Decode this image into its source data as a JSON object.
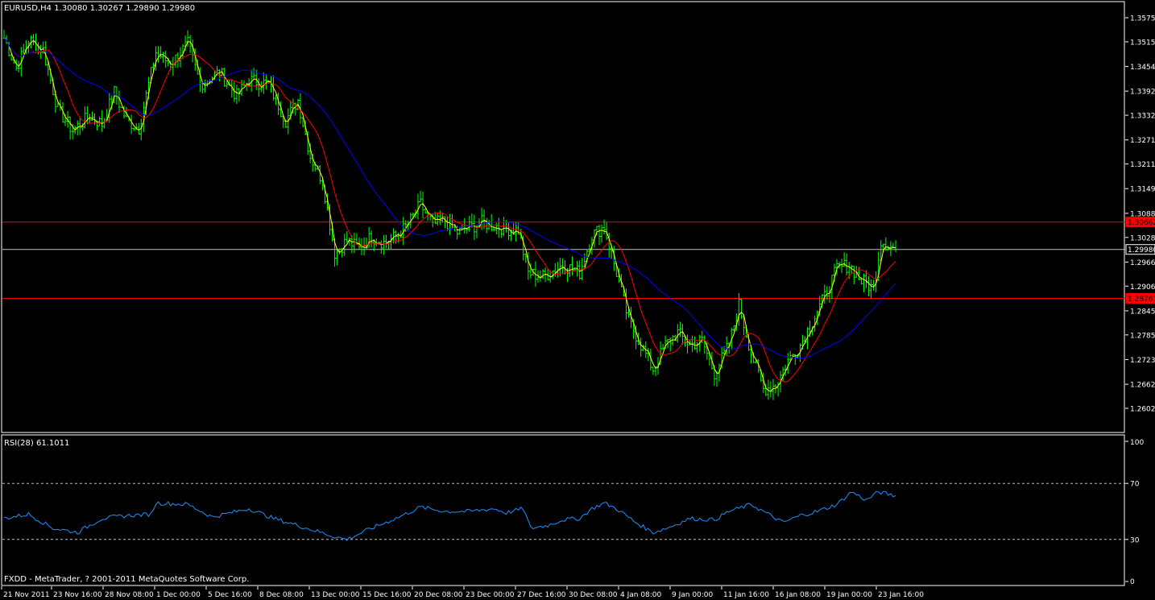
{
  "colors": {
    "background": "#000000",
    "frame": "#ffffff",
    "candle": "#00ff00",
    "ma_fast": "#ffff00",
    "ma_mid": "#ff0000",
    "ma_slow": "#0000ff",
    "resistance": "#ff0000",
    "current_price_line": "#c0c0c0",
    "rsi_line": "#1e90ff",
    "text": "#ffffff"
  },
  "chart_data": [
    {
      "type": "candlestick",
      "header": "EURUSD,H4  1.30080 1.30267 1.29890 1.29980",
      "ylim": [
        1.2602,
        1.3617
      ],
      "y_ticks": [
        "1.35755",
        "1.35155",
        "1.34540",
        "1.33925",
        "1.33325",
        "1.32710",
        "1.32110",
        "1.31495",
        "1.30880",
        "1.30280",
        "1.29665",
        "1.29065",
        "1.28450",
        "1.27850",
        "1.27235",
        "1.26620",
        "1.26020"
      ],
      "x_ticks": [
        "21 Nov 2011",
        "23 Nov 16:00",
        "28 Nov 08:00",
        "1 Dec 00:00",
        "5 Dec 16:00",
        "8 Dec 08:00",
        "13 Dec 00:00",
        "15 Dec 16:00",
        "20 Dec 08:00",
        "23 Dec 00:00",
        "27 Dec 16:00",
        "30 Dec 08:00",
        "4 Jan 08:00",
        "9 Jan 00:00",
        "11 Jan 16:00",
        "16 Jan 08:00",
        "19 Jan 00:00",
        "23 Jan 16:00"
      ],
      "close_waypoints": [
        [
          0,
          1.3525
        ],
        [
          5,
          1.345
        ],
        [
          10,
          1.352
        ],
        [
          16,
          1.3495
        ],
        [
          22,
          1.3345
        ],
        [
          28,
          1.3295
        ],
        [
          35,
          1.333
        ],
        [
          40,
          1.331
        ],
        [
          45,
          1.339
        ],
        [
          50,
          1.332
        ],
        [
          55,
          1.33
        ],
        [
          62,
          1.349
        ],
        [
          68,
          1.346
        ],
        [
          75,
          1.351
        ],
        [
          80,
          1.341
        ],
        [
          88,
          1.344
        ],
        [
          95,
          1.338
        ],
        [
          100,
          1.342
        ],
        [
          108,
          1.341
        ],
        [
          115,
          1.332
        ],
        [
          120,
          1.337
        ],
        [
          125,
          1.323
        ],
        [
          130,
          1.317
        ],
        [
          135,
          1.299
        ],
        [
          140,
          1.302
        ],
        [
          145,
          1.3
        ],
        [
          150,
          1.303
        ],
        [
          155,
          1.3015
        ],
        [
          160,
          1.303
        ],
        [
          165,
          1.306
        ],
        [
          170,
          1.311
        ],
        [
          175,
          1.306
        ],
        [
          180,
          1.307
        ],
        [
          185,
          1.304
        ],
        [
          195,
          1.3065
        ],
        [
          205,
          1.305
        ],
        [
          210,
          1.3045
        ],
        [
          214,
          1.294
        ],
        [
          220,
          1.293
        ],
        [
          228,
          1.296
        ],
        [
          235,
          1.294
        ],
        [
          240,
          1.3035
        ],
        [
          245,
          1.3055
        ],
        [
          250,
          1.294
        ],
        [
          255,
          1.282
        ],
        [
          260,
          1.276
        ],
        [
          265,
          1.27
        ],
        [
          270,
          1.276
        ],
        [
          275,
          1.279
        ],
        [
          280,
          1.276
        ],
        [
          285,
          1.277
        ],
        [
          290,
          1.269
        ],
        [
          296,
          1.276
        ],
        [
          300,
          1.286
        ],
        [
          305,
          1.274
        ],
        [
          310,
          1.265
        ],
        [
          315,
          1.266
        ],
        [
          320,
          1.272
        ],
        [
          325,
          1.276
        ],
        [
          330,
          1.282
        ],
        [
          335,
          1.288
        ],
        [
          340,
          1.295
        ],
        [
          345,
          1.296
        ],
        [
          350,
          1.292
        ],
        [
          355,
          1.29
        ],
        [
          358,
          1.302
        ],
        [
          364,
          1.2998
        ]
      ],
      "bars": 365,
      "horizontal_lines": [
        {
          "label": "1.30662",
          "price": 1.30662,
          "color": "#ff0000"
        },
        {
          "label": "1.29980",
          "price": 1.2998,
          "color": "#c0c0c0"
        },
        {
          "label": "1.28761",
          "price": 1.28761,
          "color": "#ff0000"
        }
      ],
      "moving_averages": [
        {
          "color": "#ffff00",
          "period": 3
        },
        {
          "color": "#ff0000",
          "period": 12
        },
        {
          "color": "#0000ff",
          "period": 40
        }
      ]
    },
    {
      "type": "line",
      "header": "RSI(28) 61.1011",
      "ylim": [
        0,
        100
      ],
      "y_ticks": [
        "100",
        "70",
        "30",
        "0"
      ],
      "levels": [
        70,
        30
      ],
      "rsi_waypoints": [
        [
          0,
          45
        ],
        [
          10,
          48
        ],
        [
          20,
          38
        ],
        [
          30,
          35
        ],
        [
          40,
          45
        ],
        [
          50,
          47
        ],
        [
          60,
          48
        ],
        [
          62,
          56
        ],
        [
          75,
          55
        ],
        [
          85,
          46
        ],
        [
          100,
          52
        ],
        [
          110,
          45
        ],
        [
          120,
          40
        ],
        [
          135,
          32
        ],
        [
          140,
          30
        ],
        [
          150,
          38
        ],
        [
          160,
          45
        ],
        [
          170,
          53
        ],
        [
          180,
          50
        ],
        [
          190,
          50
        ],
        [
          200,
          52
        ],
        [
          205,
          49
        ],
        [
          212,
          52
        ],
        [
          215,
          38
        ],
        [
          222,
          40
        ],
        [
          228,
          44
        ],
        [
          235,
          45
        ],
        [
          240,
          52
        ],
        [
          245,
          56
        ],
        [
          250,
          52
        ],
        [
          258,
          42
        ],
        [
          265,
          35
        ],
        [
          272,
          39
        ],
        [
          280,
          45
        ],
        [
          290,
          44
        ],
        [
          296,
          50
        ],
        [
          305,
          55
        ],
        [
          312,
          48
        ],
        [
          318,
          42
        ],
        [
          325,
          47
        ],
        [
          332,
          50
        ],
        [
          340,
          55
        ],
        [
          346,
          64
        ],
        [
          352,
          58
        ],
        [
          357,
          64
        ],
        [
          364,
          61
        ]
      ]
    }
  ],
  "footer": "FXDD - MetaTrader, ? 2001-2011 MetaQuotes Software Corp."
}
